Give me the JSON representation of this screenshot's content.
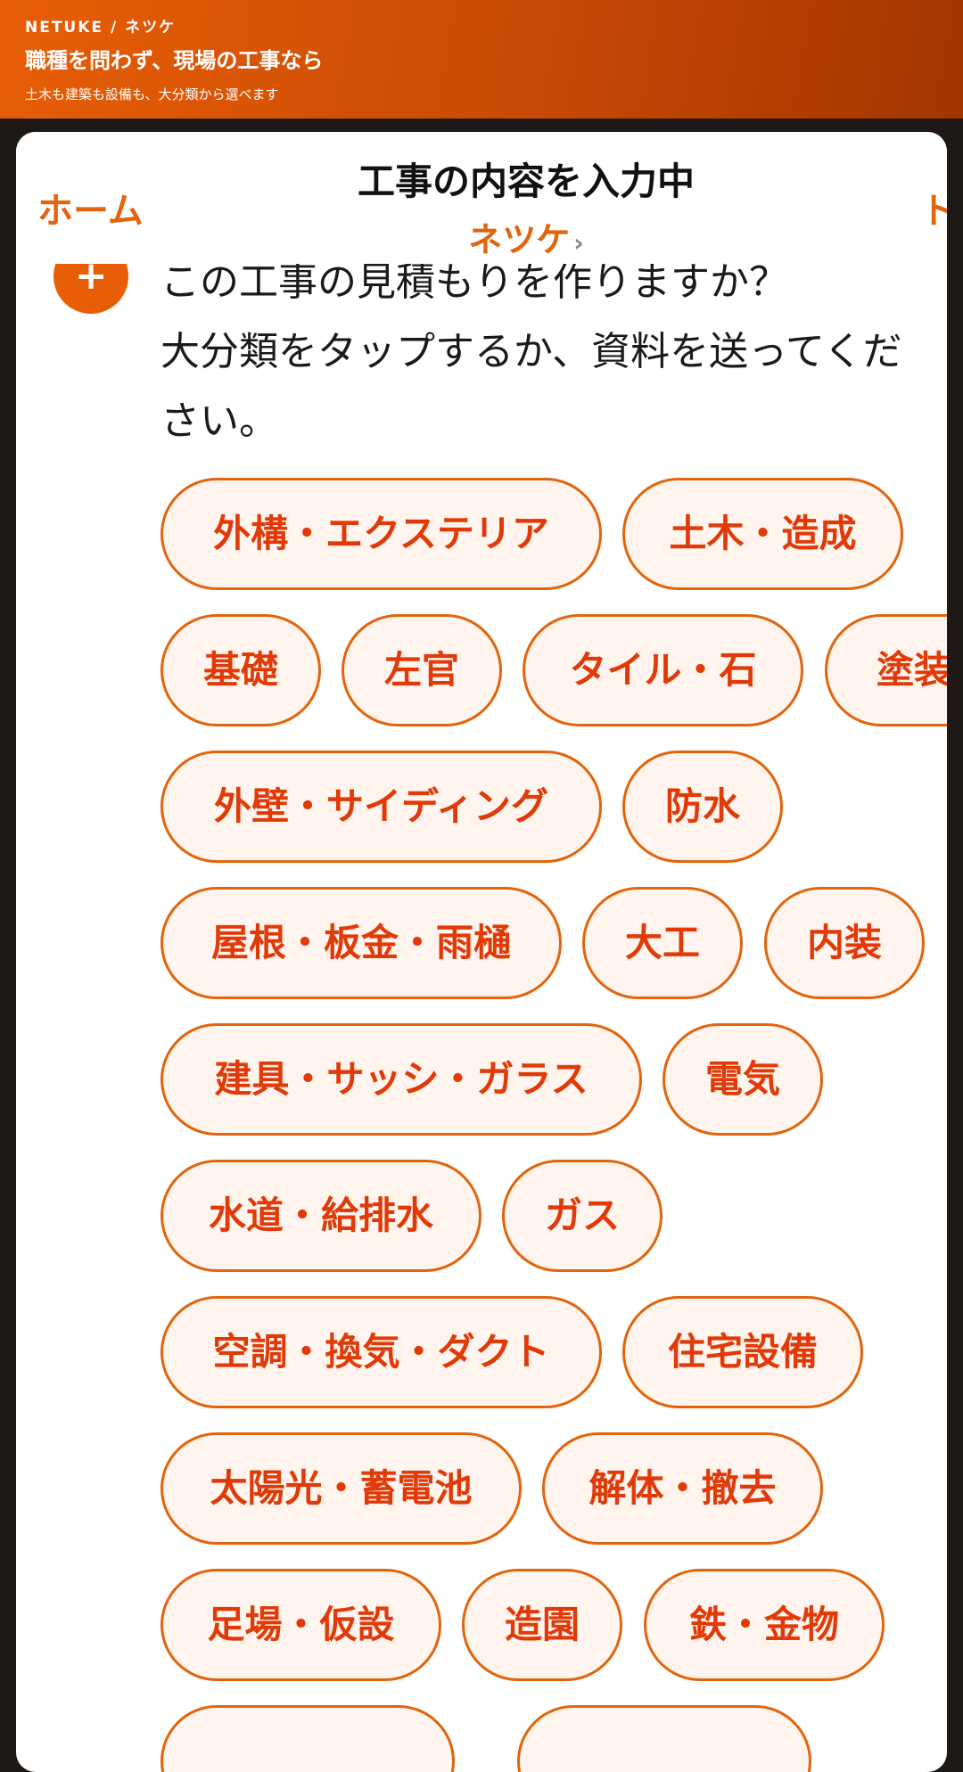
{
  "banner": {
    "brand": "NETUKE / ネツケ",
    "headline": "職種を問わず、現場の工事なら",
    "subline": "土木も建築も設備も、大分類から選べます"
  },
  "nav": {
    "home": "ホーム",
    "title": "工事の内容を入力中",
    "subtitle": "ネツケ",
    "chevron": "›",
    "right_edge": "ト"
  },
  "avatar": {
    "glyph": "+"
  },
  "message": {
    "line1": "この工事の見積もりを作りますか？",
    "line2": "大分類をタップするか、資料を送ってくだ",
    "line3": "さい。"
  },
  "categories": [
    "外構・エクステリア",
    "土木・造成",
    "基礎",
    "左官",
    "タイル・石",
    "塗装",
    "外壁・サイディング",
    "防水",
    "屋根・板金・雨樋",
    "大工",
    "内装",
    "建具・サッシ・ガラス",
    "電気",
    "水道・給排水",
    "ガス",
    "空調・換気・ダクト",
    "住宅設備",
    "太陽光・蓄電池",
    "解体・撤去",
    "足場・仮設",
    "造園",
    "鉄・金物"
  ]
}
